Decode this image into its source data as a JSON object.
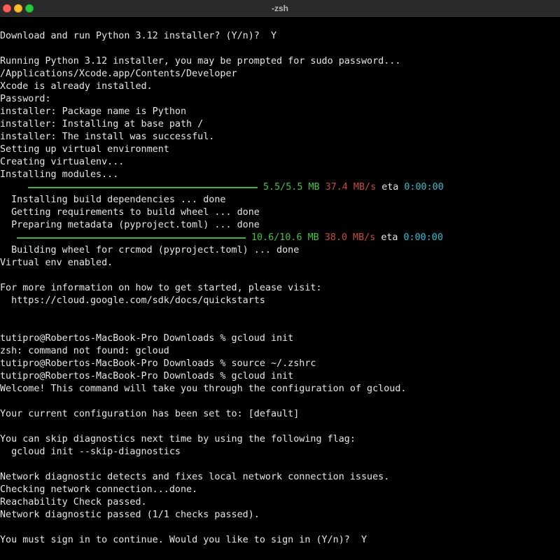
{
  "window": {
    "title": "-zsh"
  },
  "lines_top": [
    "Download and run Python 3.12 installer? (Y/n)?  Y",
    "",
    "Running Python 3.12 installer, you may be prompted for sudo password...",
    "/Applications/Xcode.app/Contents/Developer",
    "Xcode is already installed.",
    "Password:",
    "installer: Package name is Python",
    "installer: Installing at base path /",
    "installer: The install was successful.",
    "Setting up virtual environment",
    "Creating virtualenv...",
    "Installing modules..."
  ],
  "progress1": {
    "size": "5.5/5.5 MB",
    "rate": "37.4 MB/s",
    "eta_label": "eta",
    "eta": "0:00:00",
    "fraction": 1.0
  },
  "lines_mid": [
    "  Installing build dependencies ... done",
    "  Getting requirements to build wheel ... done",
    "  Preparing metadata (pyproject.toml) ... done"
  ],
  "progress2": {
    "size": "10.6/10.6 MB",
    "rate": "38.0 MB/s",
    "eta_label": "eta",
    "eta": "0:00:00",
    "fraction": 1.0
  },
  "lines_bottom": [
    "  Building wheel for crcmod (pyproject.toml) ... done",
    "Virtual env enabled.",
    "",
    "For more information on how to get started, please visit:",
    "  https://cloud.google.com/sdk/docs/quickstarts",
    "",
    "",
    "tutipro@Robertos-MacBook-Pro Downloads % gcloud init",
    "zsh: command not found: gcloud",
    "tutipro@Robertos-MacBook-Pro Downloads % source ~/.zshrc",
    "tutipro@Robertos-MacBook-Pro Downloads % gcloud init",
    "Welcome! This command will take you through the configuration of gcloud.",
    "",
    "Your current configuration has been set to: [default]",
    "",
    "You can skip diagnostics next time by using the following flag:",
    "  gcloud init --skip-diagnostics",
    "",
    "Network diagnostic detects and fixes local network connection issues.",
    "Checking network connection...done.",
    "Reachability Check passed.",
    "Network diagnostic passed (1/1 checks passed).",
    "",
    "You must sign in to continue. Would you like to sign in (Y/n)?  Y"
  ],
  "colors": {
    "progress_bar": "#3fb43f",
    "size_text": "#3fc53f",
    "rate_text": "#c94a3f",
    "eta_text": "#2fbfd0"
  }
}
